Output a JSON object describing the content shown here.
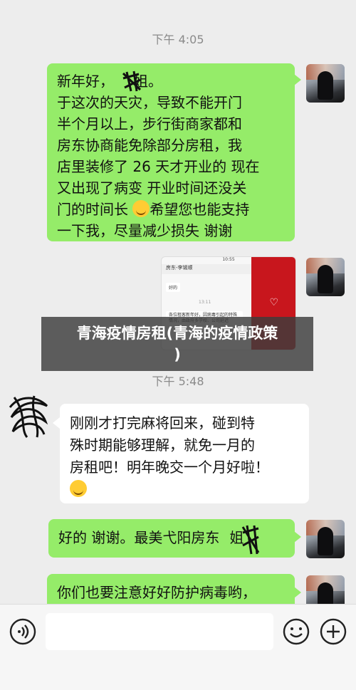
{
  "chat": {
    "timestamps": {
      "t1": "下午 4:05",
      "t2": "下午 5:48"
    },
    "messages": {
      "m1": {
        "l1": "新年好，",
        "l1b": "姐。",
        "l2": "于这次的天灾，导致不能开门",
        "l3": "半个月以上，步行街商家都和",
        "l4": "房东协商能免除部分房租，我",
        "l5": "店里装修了 26 天才开业的 现在",
        "l6": "又出现了病变 开业时间还没关",
        "l7": "门的时间长",
        "l7b": "希望您也能支持",
        "l8": "一下我，尽量减少损失 谢谢"
      },
      "m2": {
        "status_time": "10:55",
        "contact": "房东-李锡顺",
        "bubble": "好的",
        "date": "13:11",
        "notice": "各位租客新年好，因病毒引起的特殊情况，由政府多学校、公司延迟"
      },
      "m3": {
        "l1": "刚刚才打完麻将回来，碰到特",
        "l2": "殊时期能够理解，就免一月的",
        "l3": "房租吧！明年晚交一个月好啦！"
      },
      "m4": {
        "text1": "好的 谢谢。最美弋阳房东",
        "text2": "姐"
      },
      "m5": {
        "text": "你们也要注意好好防护病毒哟，"
      }
    }
  },
  "overlay": {
    "line1": "青海疫情房租(青海的疫情政策",
    "line2": ")"
  },
  "icons": {
    "voice": "voice-icon",
    "emoji": "emoji-icon",
    "plus": "plus-icon"
  }
}
